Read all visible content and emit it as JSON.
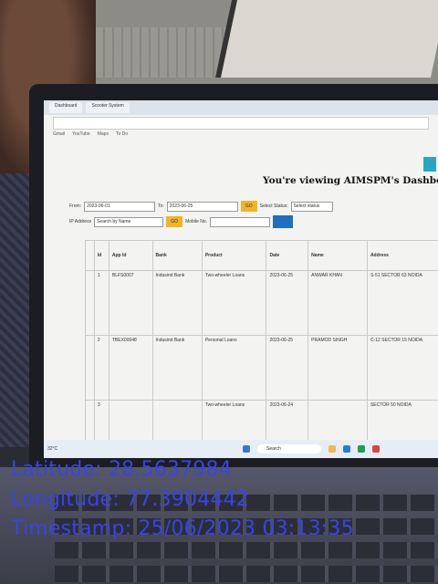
{
  "browser": {
    "tabs": [
      "Dashboard",
      "Scooter System"
    ],
    "address": "",
    "bookmarks": [
      "Gmail",
      "YouTube",
      "Maps",
      "To Do"
    ]
  },
  "dashboard": {
    "title": "You're viewing AIMSPM's Dashboard",
    "filters": {
      "from_label": "From:",
      "from_value": "2023-06-01",
      "to_label": "To:",
      "to_value": "2023-06-25",
      "search_button": "GO",
      "status_label": "Select Status:",
      "status_value": "Select status",
      "ip_label": "IP Address",
      "search_label": "Search by Name",
      "mobile_label": "Mobile No."
    },
    "table": {
      "headers": [
        "",
        "Id",
        "App Id",
        "Bank",
        "Product",
        "Date",
        "Name",
        "Address"
      ],
      "rows": [
        [
          "",
          "1",
          "BLFS0007",
          "Indusind Bank",
          "Two-wheeler Loans",
          "2023-06-25",
          "ANWAR KHAN",
          "S-51 SECTOR 63 NOIDA"
        ],
        [
          "",
          "2",
          "TBEX00048",
          "Indusind Bank",
          "Personal Loans",
          "2023-06-25",
          "PRAMOD SINGH",
          "C-12 SECTOR 15 NOIDA"
        ],
        [
          "",
          "3",
          "",
          "",
          "Two-wheeler Loans",
          "2023-06-24",
          "",
          "SECTOR 50 NOIDA"
        ]
      ]
    }
  },
  "taskbar": {
    "weather": "32°C",
    "search_placeholder": "Search"
  },
  "overlay": {
    "latitude": "Latitude: 28.5637984",
    "longitude": "Longitude: 77.3904442",
    "timestamp": "Timestamp: 25/06/2023 03:13:35"
  }
}
